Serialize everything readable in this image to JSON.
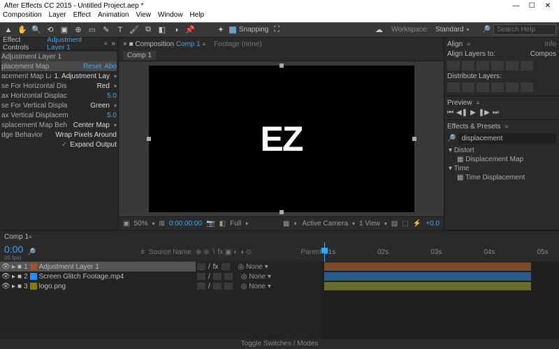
{
  "title": "After Effects CC 2015 - Untitled Project.aep *",
  "menu": [
    "Composition",
    "Layer",
    "Effect",
    "Animation",
    "View",
    "Window",
    "Help"
  ],
  "toolbar": {
    "snapping": "Snapping",
    "workspace_label": "Workspace:",
    "workspace_value": "Standard",
    "search_placeholder": "Search Help"
  },
  "effect_panel": {
    "tab": "Effect Controls",
    "target": "Adjustment Layer 1",
    "header": "Adjustment Layer 1",
    "section": "placement Map",
    "reset": "Reset",
    "about": "Abo",
    "props": [
      {
        "name": "acement Map Layer",
        "value": "1. Adjustment Lay"
      },
      {
        "name": "se For Horizontal Dis",
        "value": "Red"
      },
      {
        "name": "ax Horizontal Displac",
        "value": "5.0"
      },
      {
        "name": "se For Vertical Displa",
        "value": "Green"
      },
      {
        "name": "ax Vertical Displacem",
        "value": "5.0"
      },
      {
        "name": "splacement Map Beh",
        "value": "Center Map"
      },
      {
        "name": "dge Behavior",
        "value": "Wrap Pixels Around"
      },
      {
        "name": "",
        "value": "Expand Output"
      }
    ]
  },
  "comp_panel": {
    "tab_prefix": "Composition",
    "tab_name": "Comp 1",
    "footage_tab": "Footage (none)",
    "subtab": "Comp 1",
    "logo": "EZ",
    "zoom": "50%",
    "timecode": "0:00:00:00",
    "res": "Full",
    "camera": "Active Camera",
    "view": "1 View",
    "exposure": "+0.0"
  },
  "align": {
    "title": "Align",
    "info": "Info",
    "layers_to": "Align Layers to:",
    "layers_to_val": "Compos",
    "distribute": "Distribute Layers:"
  },
  "preview": {
    "title": "Preview"
  },
  "effects_presets": {
    "title": "Effects & Presets",
    "search": "displacement",
    "groups": [
      {
        "name": "Distort",
        "items": [
          "Displacement Map"
        ]
      },
      {
        "name": "Time",
        "items": [
          "Time Displacement"
        ]
      }
    ]
  },
  "timeline": {
    "tab": "Comp 1",
    "timecode": "0:00",
    "fps": "00 fps)",
    "ruler": [
      "01s",
      "02s",
      "03s",
      "04s",
      "05s"
    ],
    "col_source": "Source Name",
    "col_parent": "Parent",
    "layers": [
      {
        "num": "1",
        "name": "Adjustment Layer 1",
        "selected": true,
        "parent": "None",
        "chip": "c1",
        "bar": "b1"
      },
      {
        "num": "2",
        "name": "Screen Glitch Footage.mp4",
        "selected": false,
        "parent": "None",
        "chip": "c2",
        "bar": "b2"
      },
      {
        "num": "3",
        "name": "logo.png",
        "selected": false,
        "parent": "None",
        "chip": "c3",
        "bar": "b3"
      }
    ],
    "footer": "Toggle Switches / Modes"
  }
}
